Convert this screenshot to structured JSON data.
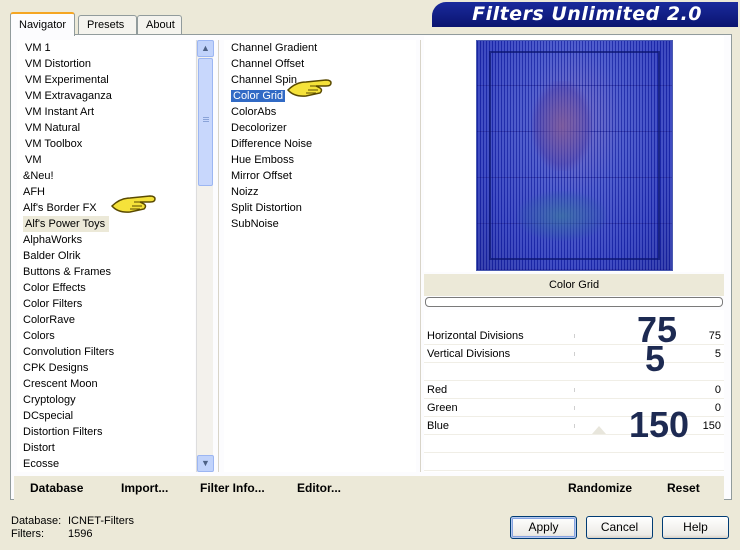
{
  "tabs": [
    {
      "label": "Navigator",
      "active": true
    },
    {
      "label": "Presets",
      "active": false
    },
    {
      "label": "About",
      "active": false
    }
  ],
  "app_title": "Filters Unlimited 2.0",
  "categories": [
    "VM 1",
    "VM Distortion",
    "VM Experimental",
    "VM Extravaganza",
    "VM Instant Art",
    "VM Natural",
    "VM Toolbox",
    "VM",
    "&Neu!",
    "AFH",
    "Alf's Border FX",
    "Alf's Power Toys",
    "AlphaWorks",
    "Balder Olrik",
    "Buttons & Frames",
    "Color Effects",
    "Color Filters",
    "ColorRave",
    "Colors",
    "Convolution Filters",
    "CPK Designs",
    "Crescent Moon",
    "Cryptology",
    "DCspecial",
    "Distortion Filters",
    "Distort",
    "Ecosse"
  ],
  "hover_category_index": 11,
  "filters": [
    "Channel Gradient",
    "Channel Offset",
    "Channel Spin",
    "Color Grid",
    "ColorAbs",
    "Decolorizer",
    "Difference Noise",
    "Hue Emboss",
    "Mirror Offset",
    "Noizz",
    "Split Distortion",
    "SubNoise"
  ],
  "selected_filter_index": 3,
  "preview": {
    "filter_name": "Color Grid",
    "progress": 0
  },
  "params": [
    {
      "label": "Horizontal Divisions",
      "value": "75"
    },
    {
      "label": "Vertical Divisions",
      "value": "5"
    },
    {
      "label": "Red",
      "value": "0"
    },
    {
      "label": "Green",
      "value": "0"
    },
    {
      "label": "Blue",
      "value": "150"
    }
  ],
  "annotations": {
    "horizontal": "75",
    "vertical": "5",
    "blue": "150"
  },
  "toolbar": {
    "database": "Database",
    "import": "Import...",
    "filter_info": "Filter Info...",
    "editor": "Editor...",
    "randomize": "Randomize",
    "reset": "Reset"
  },
  "status": {
    "database_label": "Database:",
    "database_value": "ICNET-Filters",
    "filters_label": "Filters:",
    "filters_value": "1596"
  },
  "buttons": {
    "apply": "Apply",
    "cancel": "Cancel",
    "help": "Help"
  },
  "colors": {
    "selection": "#316ac5",
    "banner": "#0a1470",
    "panel_bg": "#ece9d8",
    "hand": "#f5e23a"
  },
  "icons": {
    "pointer_hand": "pointing-hand-icon",
    "scroll_up": "arrow-up-icon",
    "scroll_down": "arrow-down-icon"
  }
}
